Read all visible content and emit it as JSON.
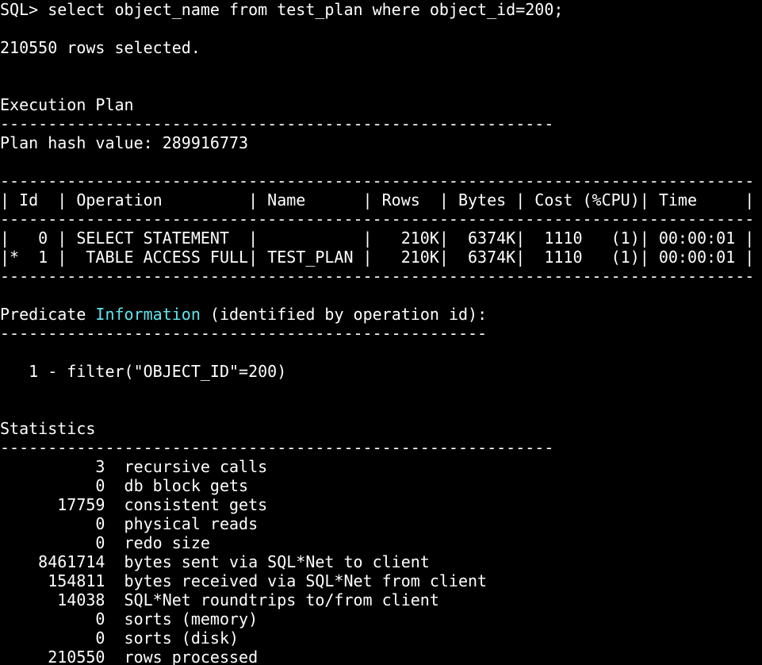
{
  "terminal": {
    "prompt": "SQL> select object_name from test_plan where object_id=200;",
    "rows_selected": "210550 rows selected.",
    "execution_plan": {
      "title": "Execution Plan",
      "rule_short": "----------------------------------------------------------",
      "hash_line": "Plan hash value: 289916773",
      "rule_long": "-------------------------------------------------------------------------------",
      "header": "| Id  | Operation         | Name      | Rows  | Bytes | Cost (%CPU)| Time     |",
      "rows": [
        "|   0 | SELECT STATEMENT  |           |   210K|  6374K|  1110   (1)| 00:00:01 |",
        "|*  1 |  TABLE ACCESS FULL| TEST_PLAN |   210K|  6374K|  1110   (1)| 00:00:01 |"
      ]
    },
    "predicate": {
      "title_prefix": "Predicate ",
      "title_highlight": "Information",
      "title_suffix": " (identified by operation id):",
      "rule": "---------------------------------------------------",
      "filter": "   1 - filter(\"OBJECT_ID\"=200)"
    },
    "statistics": {
      "title": "Statistics",
      "rule": "----------------------------------------------------------",
      "lines": [
        "          3  recursive calls",
        "          0  db block gets",
        "      17759  consistent gets",
        "          0  physical reads",
        "          0  redo size",
        "    8461714  bytes sent via SQL*Net to client",
        "     154811  bytes received via SQL*Net from client",
        "      14038  SQL*Net roundtrips to/from client",
        "          0  sorts (memory)",
        "          0  sorts (disk)",
        "     210550  rows processed"
      ]
    },
    "colors": {
      "background": "#000000",
      "text": "#ffffff",
      "highlight": "#5ee7ee"
    }
  }
}
